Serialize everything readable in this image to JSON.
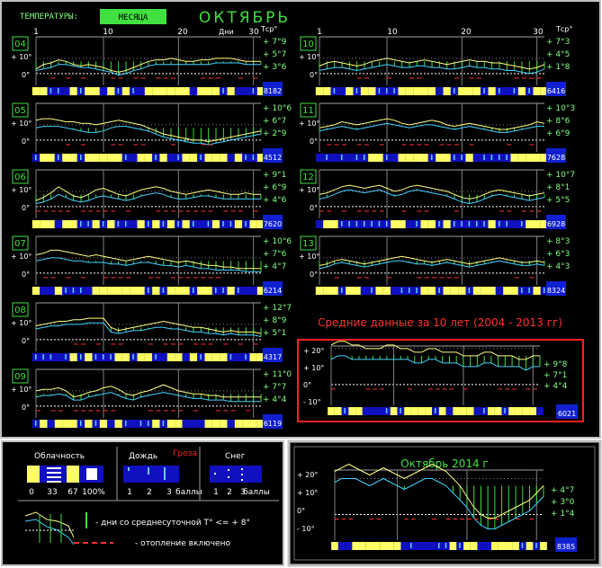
{
  "header": {
    "label": "ТЕМПЕРАТУРЫ:",
    "mode_button": "МЕСЯЦА",
    "month_title": "ОКТЯБРЬ",
    "days_label": "Дни",
    "tcp_label": "Tср°",
    "day_ticks": [
      "1",
      "10",
      "20",
      "30"
    ]
  },
  "axis_labels": [
    "+ 10°",
    "0°"
  ],
  "chart_data": [
    {
      "type": "line",
      "year_code": "04",
      "values": [
        "+ 7°9",
        "+ 5°7",
        "+ 3°6"
      ],
      "badge": "8182",
      "series": [
        {
          "values": [
            3,
            6,
            7,
            9,
            8,
            6,
            5,
            6,
            5,
            4,
            2,
            1,
            2,
            4,
            6,
            8,
            9,
            9,
            10,
            9,
            8,
            8,
            9,
            9,
            10,
            10,
            10,
            9,
            8,
            8,
            8
          ]
        },
        {
          "values": [
            2,
            3,
            4,
            6,
            6,
            5,
            4,
            4,
            3,
            2,
            1,
            -1,
            0,
            2,
            3,
            5,
            6,
            6,
            6,
            6,
            6,
            6,
            6,
            6,
            7,
            7,
            7,
            7,
            6,
            6,
            6
          ]
        }
      ]
    },
    {
      "type": "line",
      "year_code": "05",
      "values": [
        "+ 10°6",
        "+ 6°7",
        "+ 2°9"
      ],
      "badge": "4512",
      "series": [
        {
          "values": [
            13,
            14,
            14,
            13,
            12,
            12,
            11,
            11,
            10,
            11,
            12,
            13,
            12,
            11,
            10,
            8,
            6,
            4,
            3,
            2,
            1,
            0,
            0,
            -1,
            0,
            1,
            2,
            3,
            4,
            5,
            6
          ]
        },
        {
          "values": [
            8,
            9,
            9,
            9,
            8,
            7,
            6,
            5,
            5,
            6,
            8,
            9,
            9,
            8,
            7,
            6,
            4,
            2,
            1,
            0,
            -1,
            -2,
            -2,
            -3,
            -2,
            -1,
            0,
            1,
            2,
            3,
            4
          ]
        }
      ]
    },
    {
      "type": "line",
      "year_code": "06",
      "values": [
        "+ 9°1",
        "+ 6°9",
        "+ 4°6"
      ],
      "badge": "7620",
      "series": [
        {
          "values": [
            4,
            6,
            9,
            13,
            10,
            7,
            6,
            8,
            11,
            12,
            10,
            8,
            7,
            9,
            11,
            12,
            13,
            12,
            10,
            9,
            8,
            9,
            10,
            11,
            10,
            9,
            8,
            8,
            9,
            8,
            8
          ]
        },
        {
          "values": [
            2,
            3,
            5,
            8,
            6,
            4,
            3,
            4,
            6,
            7,
            6,
            5,
            4,
            5,
            7,
            8,
            9,
            8,
            6,
            5,
            5,
            6,
            7,
            7,
            6,
            5,
            5,
            5,
            5,
            5,
            5
          ]
        }
      ]
    },
    {
      "type": "line",
      "year_code": "07",
      "values": [
        "+ 10°6",
        "+ 7°6",
        "+ 4°7"
      ],
      "badge": "6214",
      "series": [
        {
          "values": [
            12,
            13,
            15,
            15,
            14,
            13,
            12,
            11,
            12,
            11,
            10,
            9,
            8,
            9,
            10,
            11,
            10,
            9,
            8,
            7,
            8,
            7,
            6,
            5,
            5,
            4,
            4,
            3,
            3,
            3,
            3
          ]
        },
        {
          "values": [
            8,
            9,
            10,
            10,
            9,
            8,
            8,
            7,
            7,
            7,
            6,
            6,
            5,
            6,
            7,
            7,
            6,
            5,
            5,
            4,
            5,
            4,
            3,
            3,
            2,
            2,
            2,
            2,
            1,
            1,
            1
          ]
        }
      ]
    },
    {
      "type": "line",
      "year_code": "08",
      "values": [
        "+ 12°7",
        "+ 8°9",
        "+ 5°1"
      ],
      "badge": "4317",
      "series": [
        {
          "values": [
            9,
            10,
            11,
            12,
            12,
            13,
            13,
            14,
            14,
            14,
            8,
            6,
            7,
            8,
            9,
            10,
            11,
            12,
            11,
            10,
            9,
            8,
            8,
            7,
            6,
            5,
            6,
            5,
            5,
            5,
            4
          ]
        },
        {
          "values": [
            7,
            8,
            9,
            9,
            10,
            10,
            10,
            11,
            11,
            11,
            5,
            4,
            5,
            6,
            6,
            7,
            8,
            8,
            7,
            7,
            6,
            5,
            5,
            4,
            4,
            3,
            4,
            3,
            3,
            3,
            2
          ]
        }
      ]
    },
    {
      "type": "line",
      "year_code": "09",
      "values": [
        "+ 11°0",
        "+ 7°7",
        "+ 4°4"
      ],
      "badge": "6119",
      "series": [
        {
          "values": [
            10,
            11,
            11,
            12,
            10,
            6,
            7,
            9,
            10,
            12,
            13,
            11,
            8,
            7,
            9,
            10,
            12,
            14,
            12,
            10,
            9,
            8,
            8,
            7,
            7,
            6,
            6,
            6,
            6,
            6,
            6
          ]
        },
        {
          "values": [
            6,
            7,
            7,
            8,
            7,
            4,
            4,
            6,
            7,
            8,
            9,
            7,
            5,
            4,
            6,
            7,
            8,
            9,
            8,
            7,
            6,
            5,
            5,
            4,
            4,
            4,
            3,
            3,
            3,
            3,
            3
          ]
        }
      ]
    },
    {
      "type": "line",
      "year_code": "10",
      "values": [
        "+ 7°3",
        "+ 4°5",
        "+ 1°8"
      ],
      "badge": "6416",
      "series": [
        {
          "values": [
            5,
            7,
            8,
            7,
            6,
            5,
            6,
            8,
            9,
            10,
            9,
            8,
            7,
            8,
            9,
            8,
            7,
            6,
            7,
            8,
            9,
            8,
            8,
            7,
            7,
            6,
            5,
            4,
            3,
            4,
            6
          ]
        },
        {
          "values": [
            2,
            3,
            4,
            4,
            3,
            2,
            3,
            4,
            5,
            6,
            5,
            4,
            4,
            5,
            5,
            4,
            4,
            3,
            3,
            4,
            5,
            4,
            4,
            3,
            3,
            2,
            2,
            1,
            0,
            1,
            3
          ]
        }
      ]
    },
    {
      "type": "line",
      "year_code": "11",
      "values": [
        "+ 10°3",
        "+ 8°6",
        "+ 6°9"
      ],
      "badge": "7628",
      "series": [
        {
          "values": [
            8,
            9,
            10,
            12,
            11,
            10,
            11,
            12,
            13,
            14,
            13,
            11,
            10,
            11,
            12,
            13,
            12,
            10,
            9,
            10,
            11,
            10,
            9,
            8,
            7,
            7,
            8,
            9,
            10,
            12,
            11
          ]
        },
        {
          "values": [
            6,
            7,
            8,
            9,
            8,
            7,
            8,
            9,
            10,
            11,
            10,
            9,
            8,
            9,
            10,
            10,
            9,
            8,
            7,
            8,
            9,
            8,
            7,
            6,
            5,
            5,
            6,
            7,
            8,
            9,
            9
          ]
        }
      ]
    },
    {
      "type": "line",
      "year_code": "12",
      "values": [
        "+ 10°7",
        "+ 8°1",
        "+ 5°5"
      ],
      "badge": "6928",
      "series": [
        {
          "values": [
            8,
            9,
            11,
            13,
            14,
            13,
            12,
            13,
            14,
            12,
            10,
            11,
            13,
            14,
            13,
            12,
            11,
            10,
            8,
            6,
            5,
            6,
            8,
            10,
            11,
            10,
            9,
            8,
            7,
            8,
            9
          ]
        },
        {
          "values": [
            5,
            6,
            8,
            10,
            11,
            10,
            9,
            10,
            11,
            9,
            7,
            8,
            10,
            11,
            10,
            9,
            8,
            7,
            5,
            3,
            2,
            3,
            5,
            7,
            8,
            7,
            6,
            5,
            4,
            5,
            6
          ]
        }
      ]
    },
    {
      "type": "line",
      "year_code": "13",
      "values": [
        "+ 8°3",
        "+ 6°3",
        "+ 4°3"
      ],
      "badge": "8324",
      "series": [
        {
          "values": [
            5,
            6,
            8,
            9,
            8,
            7,
            6,
            7,
            8,
            9,
            10,
            11,
            10,
            9,
            8,
            7,
            8,
            9,
            8,
            7,
            6,
            7,
            8,
            9,
            10,
            9,
            8,
            7,
            7,
            8,
            7
          ]
        },
        {
          "values": [
            3,
            4,
            6,
            7,
            6,
            5,
            4,
            5,
            6,
            7,
            8,
            8,
            7,
            6,
            6,
            5,
            6,
            7,
            6,
            5,
            4,
            5,
            6,
            7,
            8,
            7,
            6,
            5,
            5,
            6,
            5
          ]
        }
      ]
    }
  ],
  "avg_panel": {
    "title": "Средние данные за 10 лет (2004 - 2013 гг)",
    "axis": [
      "+ 20°",
      "+ 10°",
      "0°",
      "- 10°"
    ],
    "values": [
      "+ 9°8",
      "+ 7°1",
      "+ 4°4"
    ],
    "badge": "6021",
    "chart_data": {
      "type": "line",
      "series": [
        {
          "values": [
            11,
            12,
            12,
            11,
            11,
            10,
            10,
            10,
            11,
            11,
            10,
            10,
            9,
            9,
            10,
            10,
            9,
            9,
            9,
            8,
            8,
            8,
            9,
            9,
            8,
            8,
            8,
            7,
            7,
            8,
            8
          ]
        },
        {
          "values": [
            7,
            8,
            8,
            7,
            7,
            7,
            7,
            7,
            7,
            7,
            7,
            7,
            6,
            6,
            7,
            7,
            6,
            6,
            6,
            5,
            5,
            5,
            6,
            6,
            5,
            5,
            5,
            5,
            4,
            5,
            5
          ]
        }
      ]
    }
  },
  "current_panel": {
    "title": "Октябрь  2014 г",
    "axis": [
      "+ 20°",
      "+ 10°",
      "0°",
      "- 10°"
    ],
    "values": [
      "+ 4°7",
      "+ 3°0",
      "+ 1°4"
    ],
    "badge": "8385",
    "chart_data": {
      "type": "line",
      "series": [
        {
          "values": [
            12,
            13,
            14,
            13,
            12,
            11,
            12,
            13,
            12,
            11,
            10,
            11,
            12,
            13,
            14,
            13,
            12,
            10,
            8,
            5,
            2,
            0,
            -1,
            -1,
            0,
            1,
            2,
            3,
            4,
            6,
            8
          ]
        },
        {
          "values": [
            9,
            10,
            10,
            10,
            9,
            8,
            9,
            10,
            9,
            8,
            7,
            8,
            9,
            10,
            10,
            9,
            8,
            6,
            4,
            2,
            -1,
            -3,
            -4,
            -4,
            -3,
            -2,
            -1,
            0,
            1,
            3,
            5
          ]
        }
      ]
    }
  },
  "legend": {
    "cloud_title": "Облачность",
    "cloud_scale": [
      "0",
      "33",
      "67",
      "100%"
    ],
    "rain_title": "Дождь",
    "storm_label": "Гроза",
    "rain_scale": [
      "1",
      "2",
      "3",
      "баллы"
    ],
    "snow_title": "Снег",
    "snow_scale": [
      "1",
      "2",
      "3",
      "баллы"
    ],
    "days_line": "- дни со среднесуточной T° <= + 8°",
    "heating_line": "- отопление включено"
  },
  "colors": {
    "max_line": "#ffff80",
    "mean_line": "#40e040",
    "min_line": "#40d0ff",
    "cloud_bar": "#ffff66",
    "sky_bar": "#1010c0",
    "accent_red": "#ff2020",
    "value_text": "#80ff80",
    "heating_dash": "#ff3030"
  }
}
